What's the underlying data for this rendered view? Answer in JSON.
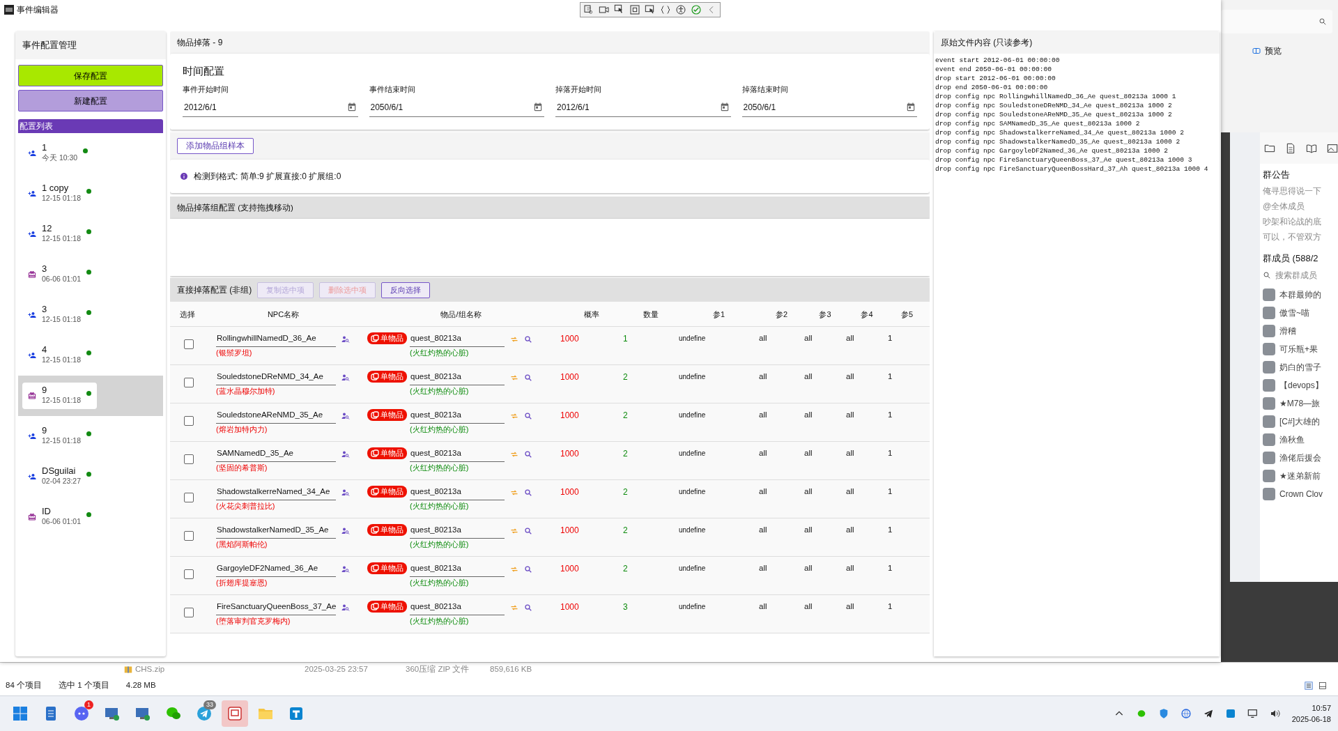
{
  "app": {
    "title": "事件编辑器"
  },
  "sidebar": {
    "title": "事件配置管理",
    "buttons": [
      {
        "label": "保存配置",
        "kind": "save"
      },
      {
        "label": "新建配置",
        "kind": "new"
      }
    ],
    "list_title": "配置列表",
    "items": [
      {
        "name": "1",
        "time": "今天 10:30",
        "kind": "person",
        "selected": false
      },
      {
        "name": "1 copy",
        "time": "12-15 01:18",
        "kind": "person",
        "selected": false
      },
      {
        "name": "12",
        "time": "12-15 01:18",
        "kind": "person",
        "selected": false
      },
      {
        "name": "3",
        "time": "06-06 01:01",
        "kind": "gift",
        "selected": false
      },
      {
        "name": "3",
        "time": "12-15 01:18",
        "kind": "person",
        "selected": false
      },
      {
        "name": "4",
        "time": "12-15 01:18",
        "kind": "person",
        "selected": false
      },
      {
        "name": "9",
        "time": "12-15 01:18",
        "kind": "gift",
        "selected": true
      },
      {
        "name": "9",
        "time": "12-15 01:18",
        "kind": "person",
        "selected": false
      },
      {
        "name": "DSguilai",
        "time": "02-04 23:27",
        "kind": "person",
        "selected": false
      },
      {
        "name": "ID",
        "time": "06-06 01:01",
        "kind": "gift",
        "selected": false
      }
    ]
  },
  "main": {
    "title": "物品掉落 - 9",
    "time_config": {
      "title": "时间配置",
      "fields": [
        {
          "label": "事件开始时间",
          "value": "2012/6/1"
        },
        {
          "label": "事件结束时间",
          "value": "2050/6/1"
        },
        {
          "label": "掉落开始时间",
          "value": "2012/6/1"
        },
        {
          "label": "掉落结束时间",
          "value": "2050/6/1"
        }
      ]
    },
    "add_button": "添加物品组样本",
    "info": "检测到格式:  简单:9 扩展直接:0 扩展组:0",
    "group_section": {
      "title": "物品掉落组配置 (支持拖拽移动)"
    },
    "direct_section": {
      "title": "直接掉落配置 (非组)",
      "buttons": [
        {
          "label": "复制选中项",
          "kind": "primary",
          "disabled": true
        },
        {
          "label": "删除选中项",
          "kind": "danger",
          "disabled": true
        },
        {
          "label": "反向选择",
          "kind": "primary",
          "disabled": false
        }
      ],
      "columns": [
        "选择",
        "NPC名称",
        "物品/组名称",
        "概率",
        "数量",
        "参1",
        "参2",
        "参3",
        "参4",
        "参5"
      ],
      "rows": [
        {
          "checked": false,
          "npc": "RollingwhillNamedD_36_Ae",
          "npc_cn": "(银鬃罗坦)",
          "tag": "单物品",
          "item": "quest_80213a",
          "item_cn": "(火红灼热的心脏)",
          "rate": "1000",
          "count": "1",
          "p1": "undefine",
          "p2": "all",
          "p3": "all",
          "p4": "all",
          "p5": "1"
        },
        {
          "checked": false,
          "npc": "SouledstoneDReNMD_34_Ae",
          "npc_cn": "(蓝水晶穆尔加特)",
          "tag": "单物品",
          "item": "quest_80213a",
          "item_cn": "(火红灼热的心脏)",
          "rate": "1000",
          "count": "2",
          "p1": "undefine",
          "p2": "all",
          "p3": "all",
          "p4": "all",
          "p5": "1"
        },
        {
          "checked": false,
          "npc": "SouledstoneAReNMD_35_Ae",
          "npc_cn": "(熔岩加特内力)",
          "tag": "单物品",
          "item": "quest_80213a",
          "item_cn": "(火红灼热的心脏)",
          "rate": "1000",
          "count": "2",
          "p1": "undefine",
          "p2": "all",
          "p3": "all",
          "p4": "all",
          "p5": "1"
        },
        {
          "checked": false,
          "npc": "SAMNamedD_35_Ae",
          "npc_cn": "(坚固的希普斯)",
          "tag": "单物品",
          "item": "quest_80213a",
          "item_cn": "(火红灼热的心脏)",
          "rate": "1000",
          "count": "2",
          "p1": "undefine",
          "p2": "all",
          "p3": "all",
          "p4": "all",
          "p5": "1"
        },
        {
          "checked": false,
          "npc": "ShadowstalkerreNamed_34_Ae",
          "npc_cn": "(火花尖刺普拉比)",
          "tag": "单物品",
          "item": "quest_80213a",
          "item_cn": "(火红灼热的心脏)",
          "rate": "1000",
          "count": "2",
          "p1": "undefine",
          "p2": "all",
          "p3": "all",
          "p4": "all",
          "p5": "1"
        },
        {
          "checked": false,
          "npc": "ShadowstalkerNamedD_35_Ae",
          "npc_cn": "(黑焰阿斯帕伦)",
          "tag": "单物品",
          "item": "quest_80213a",
          "item_cn": "(火红灼热的心脏)",
          "rate": "1000",
          "count": "2",
          "p1": "undefine",
          "p2": "all",
          "p3": "all",
          "p4": "all",
          "p5": "1"
        },
        {
          "checked": false,
          "npc": "GargoyleDF2Named_36_Ae",
          "npc_cn": "(折翅库提塞恩)",
          "tag": "单物品",
          "item": "quest_80213a",
          "item_cn": "(火红灼热的心脏)",
          "rate": "1000",
          "count": "2",
          "p1": "undefine",
          "p2": "all",
          "p3": "all",
          "p4": "all",
          "p5": "1"
        },
        {
          "checked": false,
          "npc": "FireSanctuaryQueenBoss_37_Ae",
          "npc_cn": "(堕落审判官克罗梅内)",
          "tag": "单物品",
          "item": "quest_80213a",
          "item_cn": "(火红灼热的心脏)",
          "rate": "1000",
          "count": "3",
          "p1": "undefine",
          "p2": "all",
          "p3": "all",
          "p4": "all",
          "p5": "1"
        }
      ]
    }
  },
  "raw": {
    "title": "原始文件内容 (只读参考)",
    "lines": [
      "event start 2012-06-01 00:00:00",
      "event end 2050-06-01 00:00:00",
      "drop start 2012-06-01 00:00:00",
      "drop end 2050-06-01 00:00:00",
      "drop config npc RollingwhillNamedD_36_Ae quest_80213a 1000 1",
      "drop config npc SouledstoneDReNMD_34_Ae quest_80213a 1000 2",
      "drop config npc SouledstoneAReNMD_35_Ae quest_80213a 1000 2",
      "drop config npc SAMNamedD_35_Ae quest_80213a 1000 2",
      "drop config npc ShadowstalkerreNamed_34_Ae quest_80213a 1000 2",
      "drop config npc ShadowstalkerNamedD_35_Ae quest_80213a 1000 2",
      "drop config npc GargoyleDF2Named_36_Ae quest_80213a 1000 2",
      "drop config npc FireSanctuaryQueenBoss_37_Ae quest_80213a 1000 3",
      "drop config npc FireSanctuaryQueenBossHard_37_Ah quest_80213a 1000 4"
    ]
  },
  "side_window": {
    "preview": "预览"
  },
  "chat": {
    "notice_title": "群公告",
    "notice_lines": [
      "俺寻思得说一下",
      "@全体成员",
      "吵架和论战的底",
      "可以，不管双方"
    ],
    "members_title": "群成员 (588/2",
    "search": {
      "placeholder": "搜索群成员"
    },
    "members": [
      {
        "name": "本群最帅的"
      },
      {
        "name": "傲雪~喵"
      },
      {
        "name": "滑稽"
      },
      {
        "name": "可乐瓶+果"
      },
      {
        "name": "奶白的雪子"
      },
      {
        "name": "【devops】"
      },
      {
        "name": "★M78—旅"
      },
      {
        "name": "[C#]大雄的"
      },
      {
        "name": "渔秋鱼"
      },
      {
        "name": "渔佬后援会"
      },
      {
        "name": "★迷弟新前"
      },
      {
        "name": "Crown Clov"
      }
    ]
  },
  "explorer": {
    "file": {
      "name": "CHS.zip",
      "modified": "2025-03-25 23:57",
      "type": "360压缩 ZIP 文件",
      "size": "859,616 KB"
    },
    "status": [
      "84 个项目",
      "选中 1 个项目",
      "4.28 MB"
    ]
  },
  "taskbar": {
    "apps": [
      {
        "kind": "start",
        "selected": false
      },
      {
        "kind": "notepad",
        "selected": false
      },
      {
        "kind": "discord",
        "badge": "1",
        "selected": false
      },
      {
        "kind": "remote",
        "selected": false
      },
      {
        "kind": "remote",
        "selected": false
      },
      {
        "kind": "wechat",
        "selected": false
      },
      {
        "kind": "telegram",
        "badge": "33",
        "selected": false
      },
      {
        "kind": "editor",
        "selected": true
      },
      {
        "kind": "folder",
        "selected": false
      },
      {
        "kind": "blueapp",
        "selected": false
      }
    ],
    "time": "10:57",
    "date": "2025-06-18"
  }
}
